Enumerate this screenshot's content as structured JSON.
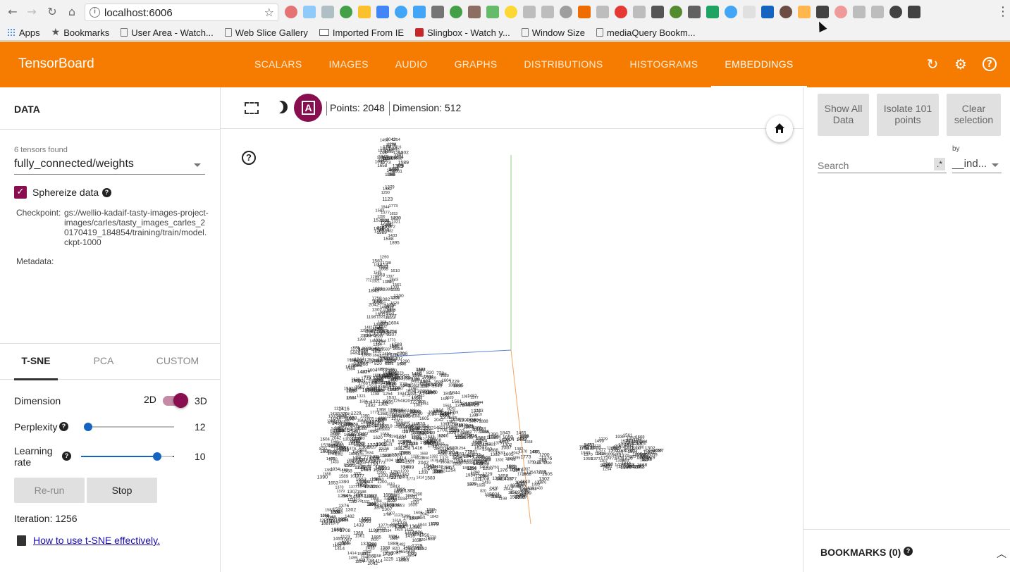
{
  "browser": {
    "url": "localhost:6006",
    "bookmarks": [
      {
        "label": "Apps",
        "icon": "apps-icon"
      },
      {
        "label": "Bookmarks",
        "icon": "star-icon"
      },
      {
        "label": "User Area - Watch...",
        "icon": "page-icon"
      },
      {
        "label": "Web Slice Gallery",
        "icon": "page-icon"
      },
      {
        "label": "Imported From IE",
        "icon": "folder-icon"
      },
      {
        "label": "Slingbox - Watch y...",
        "icon": "slingbox-icon"
      },
      {
        "label": "Window Size",
        "icon": "page-icon"
      },
      {
        "label": "mediaQuery Bookm...",
        "icon": "page-icon"
      }
    ],
    "extension_colors": [
      "#e57373",
      "#90caf9",
      "#b0bec5",
      "#43a047",
      "#fbc02d",
      "#4285f4",
      "#42a5f5",
      "#42a5f5",
      "#757575",
      "#43a047",
      "#8d6e63",
      "#66bb6a",
      "#fdd835",
      "#bdbdbd",
      "#bdbdbd",
      "#9e9e9e",
      "#ef6c00",
      "#bdbdbd",
      "#e53935",
      "#bdbdbd",
      "#555555",
      "#558b2f",
      "#616161",
      "#1ea362",
      "#42a5f5",
      "#e0e0e0",
      "#1565c0",
      "#6d4c41",
      "#ffb74d",
      "#424242",
      "#ef9a9a",
      "#bdbdbd",
      "#bdbdbd",
      "#424242",
      "#424242"
    ]
  },
  "header": {
    "title": "TensorBoard",
    "tabs": [
      "SCALARS",
      "IMAGES",
      "AUDIO",
      "GRAPHS",
      "DISTRIBUTIONS",
      "HISTOGRAMS",
      "EMBEDDINGS"
    ],
    "active_tab": "EMBEDDINGS",
    "accent": "#f57c00",
    "icons": [
      "refresh-icon",
      "settings-icon",
      "help-icon"
    ]
  },
  "data_panel": {
    "title": "DATA",
    "tensors_found": "6 tensors found",
    "tensor": "fully_connected/weights",
    "sphereize_label": "Sphereize data",
    "sphereize_checked": true,
    "checkpoint_label": "Checkpoint:",
    "checkpoint_value": "gs://wellio-kadaif-tasty-images-project-images/carles/tasty_images_carles_20170419_184854/training/train/model.ckpt-1000",
    "metadata_label": "Metadata:"
  },
  "projection": {
    "tabs": [
      "T-SNE",
      "PCA",
      "CUSTOM"
    ],
    "active_tab": "T-SNE",
    "dimension_label": "Dimension",
    "dim_2d": "2D",
    "dim_3d": "3D",
    "dimension_value": "3D",
    "perplexity_label": "Perplexity",
    "perplexity_value": "12",
    "perplexity_fraction": 0.04,
    "learning_rate_label_1": "Learning",
    "learning_rate_label_2": "rate",
    "learning_rate_value": "10",
    "learning_rate_fraction": 0.82,
    "rerun_label": "Re-run",
    "stop_label": "Stop",
    "iteration_text": "Iteration: 1256",
    "howto_link": "How to use t-SNE effectively.",
    "accent": "#880e4f",
    "slider_color": "#1565c0"
  },
  "toolbar": {
    "points_text": "Points: 2048",
    "dimension_text": "Dimension: 512",
    "label_icon_text": "A"
  },
  "scatter": {
    "axis_colors": {
      "x": "#5c85d6",
      "y": "#8bd17c",
      "z": "#f4a460"
    },
    "sample_labels": [
      "1087",
      "1465",
      "820",
      "1773",
      "1895",
      "1531",
      "1934",
      "1589",
      "1379",
      "1229",
      "1729",
      "1583",
      "1382",
      "1200",
      "772",
      "1416",
      "1844",
      "1390",
      "1653",
      "1658",
      "1254",
      "1843",
      "1370",
      "1198",
      "1059",
      "1302",
      "2042",
      "1668",
      "1888",
      "1376",
      "1604",
      "1620",
      "1605",
      "1750",
      "1610",
      "1561",
      "1499",
      "1414",
      "1368",
      "1254",
      "1708",
      "1930",
      "1588",
      "1482",
      "1377",
      "1433",
      "1321",
      "1123",
      "1290",
      "1307"
    ]
  },
  "right_panel": {
    "show_all": "Show All Data",
    "isolate": "Isolate 101 points",
    "clear": "Clear selection",
    "search_placeholder": "Search",
    "regex_label": ".*",
    "by_label": "by",
    "by_value": "__ind...",
    "bookmarks_title": "BOOKMARKS (0)"
  }
}
